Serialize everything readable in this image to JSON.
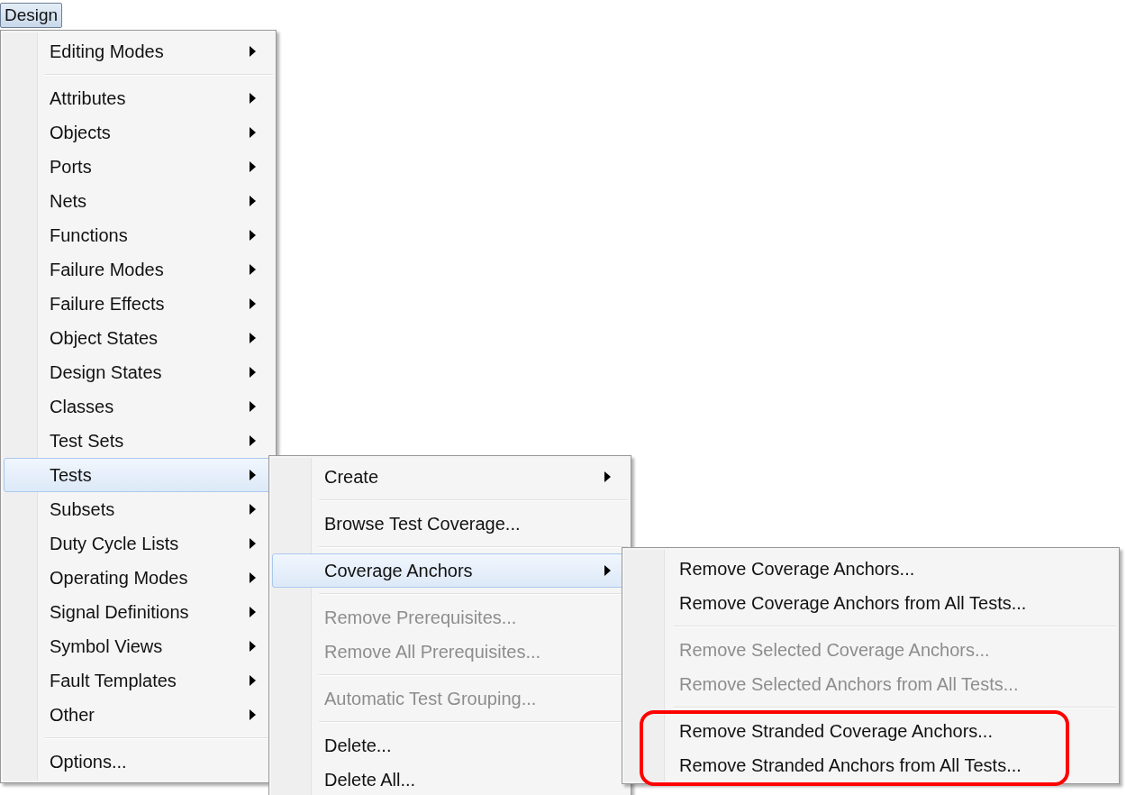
{
  "menu_button": {
    "label": "Design",
    "pressed": true
  },
  "menus": [
    {
      "sections": [
        {
          "highlighted": false,
          "items": [
            {
              "label": "Editing Modes",
              "has_submenu": true,
              "disabled": false,
              "selected": false
            }
          ]
        },
        {
          "highlighted": false,
          "items": [
            {
              "label": "Attributes",
              "has_submenu": true,
              "disabled": false,
              "selected": false
            },
            {
              "label": "Objects",
              "has_submenu": true,
              "disabled": false,
              "selected": false
            },
            {
              "label": "Ports",
              "has_submenu": true,
              "disabled": false,
              "selected": false
            },
            {
              "label": "Nets",
              "has_submenu": true,
              "disabled": false,
              "selected": false
            },
            {
              "label": "Functions",
              "has_submenu": true,
              "disabled": false,
              "selected": false
            },
            {
              "label": "Failure Modes",
              "has_submenu": true,
              "disabled": false,
              "selected": false
            },
            {
              "label": "Failure Effects",
              "has_submenu": true,
              "disabled": false,
              "selected": false
            },
            {
              "label": "Object States",
              "has_submenu": true,
              "disabled": false,
              "selected": false
            },
            {
              "label": "Design States",
              "has_submenu": true,
              "disabled": false,
              "selected": false
            },
            {
              "label": "Classes",
              "has_submenu": true,
              "disabled": false,
              "selected": false
            },
            {
              "label": "Test Sets",
              "has_submenu": true,
              "disabled": false,
              "selected": false
            },
            {
              "label": "Tests",
              "has_submenu": true,
              "disabled": false,
              "selected": true
            },
            {
              "label": "Subsets",
              "has_submenu": true,
              "disabled": false,
              "selected": false
            },
            {
              "label": "Duty Cycle Lists",
              "has_submenu": true,
              "disabled": false,
              "selected": false
            },
            {
              "label": "Operating Modes",
              "has_submenu": true,
              "disabled": false,
              "selected": false
            },
            {
              "label": "Signal Definitions",
              "has_submenu": true,
              "disabled": false,
              "selected": false
            },
            {
              "label": "Symbol Views",
              "has_submenu": true,
              "disabled": false,
              "selected": false
            },
            {
              "label": "Fault Templates",
              "has_submenu": true,
              "disabled": false,
              "selected": false
            },
            {
              "label": "Other",
              "has_submenu": true,
              "disabled": false,
              "selected": false
            }
          ]
        },
        {
          "highlighted": false,
          "items": [
            {
              "label": "Options...",
              "has_submenu": false,
              "disabled": false,
              "selected": false
            }
          ]
        }
      ]
    },
    {
      "sections": [
        {
          "highlighted": false,
          "items": [
            {
              "label": "Create",
              "has_submenu": true,
              "disabled": false,
              "selected": false
            }
          ]
        },
        {
          "highlighted": false,
          "items": [
            {
              "label": "Browse Test Coverage...",
              "has_submenu": false,
              "disabled": false,
              "selected": false
            }
          ]
        },
        {
          "highlighted": false,
          "items": [
            {
              "label": "Coverage Anchors",
              "has_submenu": true,
              "disabled": false,
              "selected": true
            }
          ]
        },
        {
          "highlighted": false,
          "items": [
            {
              "label": "Remove Prerequisites...",
              "has_submenu": false,
              "disabled": true,
              "selected": false
            },
            {
              "label": "Remove All Prerequisites...",
              "has_submenu": false,
              "disabled": true,
              "selected": false
            }
          ]
        },
        {
          "highlighted": false,
          "items": [
            {
              "label": "Automatic Test Grouping...",
              "has_submenu": false,
              "disabled": true,
              "selected": false
            }
          ]
        },
        {
          "highlighted": false,
          "items": [
            {
              "label": "Delete...",
              "has_submenu": false,
              "disabled": false,
              "selected": false
            },
            {
              "label": "Delete All...",
              "has_submenu": false,
              "disabled": false,
              "selected": false
            }
          ]
        }
      ]
    },
    {
      "sections": [
        {
          "highlighted": false,
          "items": [
            {
              "label": "Remove Coverage Anchors...",
              "has_submenu": false,
              "disabled": false,
              "selected": false
            },
            {
              "label": "Remove Coverage Anchors from All Tests...",
              "has_submenu": false,
              "disabled": false,
              "selected": false
            }
          ]
        },
        {
          "highlighted": false,
          "items": [
            {
              "label": "Remove Selected Coverage Anchors...",
              "has_submenu": false,
              "disabled": true,
              "selected": false
            },
            {
              "label": "Remove Selected Anchors from All Tests...",
              "has_submenu": false,
              "disabled": true,
              "selected": false
            }
          ]
        },
        {
          "highlighted": true,
          "items": [
            {
              "label": "Remove Stranded Coverage Anchors...",
              "has_submenu": false,
              "disabled": false,
              "selected": false
            },
            {
              "label": "Remove Stranded Anchors from All Tests...",
              "has_submenu": false,
              "disabled": false,
              "selected": false
            }
          ]
        }
      ]
    }
  ]
}
